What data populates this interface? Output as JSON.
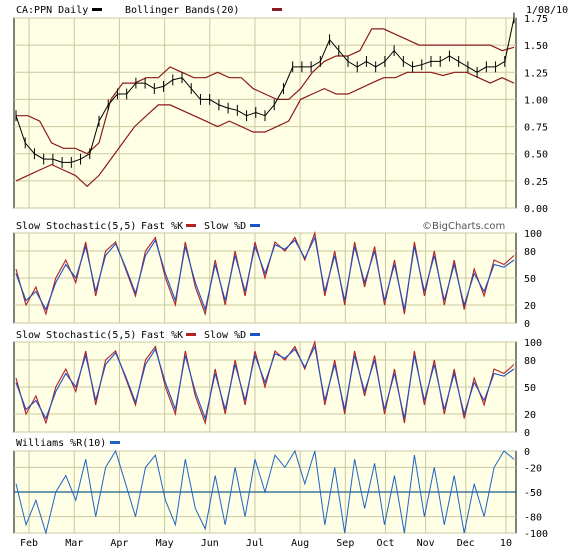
{
  "header": {
    "symbol_label": "CA:PPN Daily",
    "overlay_label": "Bollinger Bands(20)",
    "date_label": "1/08/10",
    "watermark": "©BigCharts.com",
    "symbol_color": "#000000",
    "overlay_color": "#8b1a1a"
  },
  "panels": {
    "stoch1": {
      "title": "Slow Stochastic(5,5)",
      "fast_label": "Fast %K",
      "slow_label": "Slow %D"
    },
    "stoch2": {
      "title": "Slow Stochastic(5,5)",
      "fast_label": "Fast %K",
      "slow_label": "Slow %D"
    },
    "williams": {
      "title": "Williams %R(10)"
    }
  },
  "colors": {
    "panel_bg": "#ffffe6",
    "grid": "#c8c8a0",
    "price": "#000000",
    "band": "#8b1a1a",
    "fast": "#b22222",
    "slow": "#1e50c8",
    "williams": "#1e64c8",
    "ref_line": "#1a5a8a"
  },
  "chart_data": [
    {
      "type": "line",
      "title": "CA:PPN Daily",
      "xlabel": "",
      "ylabel": "",
      "ylim": [
        0,
        1.75
      ],
      "y_ticks": [
        "0.00",
        "0.25",
        "0.50",
        "0.75",
        "1.00",
        "1.25",
        "1.50",
        "1.75"
      ],
      "x_ticks": [
        "Feb",
        "Mar",
        "Apr",
        "May",
        "Jun",
        "Jul",
        "Aug",
        "Sep",
        "Oct",
        "Nov",
        "Dec",
        "10"
      ],
      "grid": true,
      "series": [
        {
          "name": "CA:PPN Daily",
          "values": [
            0.85,
            0.6,
            0.5,
            0.45,
            0.45,
            0.42,
            0.42,
            0.45,
            0.5,
            0.8,
            0.95,
            1.05,
            1.05,
            1.15,
            1.15,
            1.1,
            1.12,
            1.18,
            1.2,
            1.1,
            1.0,
            1.0,
            0.95,
            0.92,
            0.9,
            0.85,
            0.88,
            0.85,
            0.95,
            1.1,
            1.3,
            1.3,
            1.3,
            1.35,
            1.55,
            1.45,
            1.35,
            1.3,
            1.35,
            1.3,
            1.35,
            1.45,
            1.35,
            1.3,
            1.32,
            1.35,
            1.35,
            1.4,
            1.35,
            1.3,
            1.25,
            1.3,
            1.3,
            1.35,
            1.75
          ]
        },
        {
          "name": "Bollinger Bands(20)",
          "upper": [
            0.85,
            0.85,
            0.8,
            0.6,
            0.55,
            0.55,
            0.5,
            0.6,
            1.0,
            1.15,
            1.15,
            1.2,
            1.2,
            1.3,
            1.25,
            1.2,
            1.2,
            1.25,
            1.2,
            1.2,
            1.1,
            1.05,
            1.0,
            1.0,
            1.1,
            1.25,
            1.35,
            1.4,
            1.4,
            1.45,
            1.65,
            1.65,
            1.6,
            1.55,
            1.5,
            1.5,
            1.5,
            1.5,
            1.5,
            1.5,
            1.5,
            1.45,
            1.48
          ],
          "lower": [
            0.25,
            0.3,
            0.35,
            0.4,
            0.35,
            0.3,
            0.2,
            0.3,
            0.45,
            0.6,
            0.75,
            0.85,
            0.95,
            0.95,
            0.9,
            0.85,
            0.8,
            0.75,
            0.8,
            0.75,
            0.7,
            0.7,
            0.75,
            0.8,
            1.0,
            1.05,
            1.1,
            1.05,
            1.05,
            1.1,
            1.15,
            1.2,
            1.2,
            1.25,
            1.25,
            1.25,
            1.22,
            1.25,
            1.25,
            1.2,
            1.15,
            1.2,
            1.15
          ]
        }
      ]
    },
    {
      "type": "line",
      "title": "Slow Stochastic(5,5)",
      "xlabel": "",
      "ylabel": "",
      "ylim": [
        0,
        100
      ],
      "y_ticks": [
        "0",
        "20",
        "50",
        "80",
        "100"
      ],
      "grid": true,
      "series": [
        {
          "name": "Fast %K",
          "values": [
            60,
            20,
            40,
            10,
            50,
            70,
            45,
            90,
            30,
            80,
            90,
            60,
            30,
            80,
            95,
            50,
            20,
            90,
            40,
            10,
            70,
            20,
            80,
            30,
            90,
            50,
            90,
            80,
            95,
            70,
            100,
            30,
            80,
            20,
            90,
            40,
            85,
            20,
            70,
            10,
            90,
            30,
            80,
            20,
            70,
            15,
            60,
            30,
            70,
            65,
            75
          ]
        },
        {
          "name": "Slow %D",
          "values": [
            55,
            25,
            35,
            15,
            45,
            65,
            50,
            85,
            35,
            75,
            88,
            62,
            33,
            75,
            92,
            55,
            25,
            85,
            45,
            15,
            65,
            25,
            75,
            35,
            85,
            55,
            87,
            82,
            92,
            72,
            95,
            35,
            75,
            25,
            85,
            45,
            80,
            25,
            65,
            15,
            85,
            35,
            75,
            25,
            65,
            20,
            55,
            35,
            65,
            62,
            70
          ]
        }
      ]
    },
    {
      "type": "line",
      "title": "Slow Stochastic(5,5)",
      "xlabel": "",
      "ylabel": "",
      "ylim": [
        0,
        100
      ],
      "y_ticks": [
        "0",
        "20",
        "50",
        "80",
        "100"
      ],
      "grid": true,
      "series": [
        {
          "name": "Fast %K",
          "values": [
            60,
            20,
            40,
            10,
            50,
            70,
            45,
            90,
            30,
            80,
            90,
            60,
            30,
            80,
            95,
            50,
            20,
            90,
            40,
            10,
            70,
            20,
            80,
            30,
            90,
            50,
            90,
            80,
            95,
            70,
            100,
            30,
            80,
            20,
            90,
            40,
            85,
            20,
            70,
            10,
            90,
            30,
            80,
            20,
            70,
            15,
            60,
            30,
            70,
            65,
            75
          ]
        },
        {
          "name": "Slow %D",
          "values": [
            55,
            25,
            35,
            15,
            45,
            65,
            50,
            85,
            35,
            75,
            88,
            62,
            33,
            75,
            92,
            55,
            25,
            85,
            45,
            15,
            65,
            25,
            75,
            35,
            85,
            55,
            87,
            82,
            92,
            72,
            95,
            35,
            75,
            25,
            85,
            45,
            80,
            25,
            65,
            15,
            85,
            35,
            75,
            25,
            65,
            20,
            55,
            35,
            65,
            62,
            70
          ]
        }
      ]
    },
    {
      "type": "line",
      "title": "Williams %R(10)",
      "xlabel": "",
      "ylabel": "",
      "ylim": [
        -100,
        0
      ],
      "y_ticks": [
        "0",
        "-20",
        "-50",
        "-80",
        "-100"
      ],
      "grid": true,
      "series": [
        {
          "name": "Williams %R(10)",
          "values": [
            -40,
            -90,
            -60,
            -100,
            -50,
            -30,
            -60,
            -10,
            -80,
            -20,
            0,
            -40,
            -80,
            -20,
            -5,
            -60,
            -90,
            -10,
            -70,
            -95,
            -30,
            -90,
            -20,
            -80,
            -10,
            -50,
            -5,
            -20,
            0,
            -40,
            0,
            -90,
            -20,
            -100,
            -10,
            -70,
            -15,
            -90,
            -30,
            -100,
            -5,
            -80,
            -20,
            -90,
            -30,
            -100,
            -40,
            -80,
            -20,
            0,
            -10
          ]
        }
      ]
    }
  ]
}
